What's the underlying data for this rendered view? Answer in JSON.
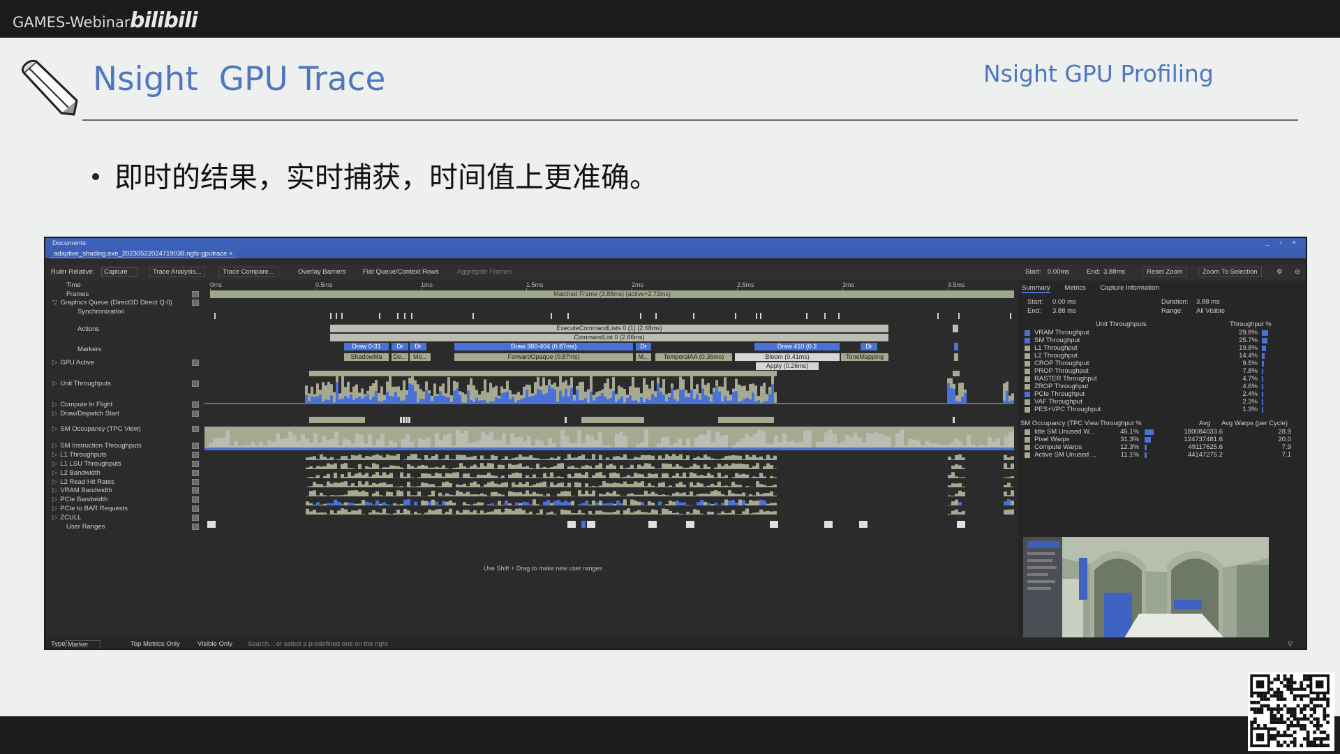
{
  "header": {
    "brand": "GAMES-Webinar",
    "brand_logo": "bilibili"
  },
  "slide": {
    "title": "Nsight  GPU Trace",
    "tag": "Nsight GPU Profiling",
    "bullet": "即时的结果，实时捕获，时间值上更准确。"
  },
  "window": {
    "title": "Documents",
    "doc_tab": "adaptive_shading.exe_20230522024719038.ngfx-gputrace",
    "toolbar": {
      "ruler_relative_label": "Ruler Relative:",
      "ruler_relative_value": "Capture",
      "trace_analysis": "Trace Analysis...",
      "trace_compare": "Trace Compare...",
      "overlay_barriers": "Overlay Barriers",
      "flat_queue": "Flat Queue/Context Rows",
      "aggregate_frames": "Aggregate Frames",
      "start_label": "Start:",
      "start_value": "0.00ms",
      "end_label": "End:",
      "end_value": "3.88ms",
      "reset_zoom": "Reset Zoom",
      "zoom_to_selection": "Zoom To Selection"
    },
    "ruler": [
      "0ms",
      "0.5ms",
      "1ms",
      "1.5ms",
      "2ms",
      "2.5ms",
      "3ms",
      "3.5ms"
    ],
    "rows": [
      {
        "label": "Time",
        "indent": 1,
        "tri": ""
      },
      {
        "label": "Frames",
        "indent": 1,
        "tri": ""
      },
      {
        "label": "Graphics Queue (Direct3D Direct Q:0)",
        "indent": 0,
        "tri": "▽"
      },
      {
        "label": "Synchronization",
        "indent": 2,
        "tri": ""
      },
      {
        "label": "Actions",
        "indent": 2,
        "tri": ""
      },
      {
        "label": "Markers",
        "indent": 2,
        "tri": ""
      },
      {
        "label": "GPU Active",
        "indent": 0,
        "tri": "▷"
      },
      {
        "label": "Unit Throughputs",
        "indent": 0,
        "tri": "▷"
      },
      {
        "label": "Compute In Flight",
        "indent": 0,
        "tri": "▷"
      },
      {
        "label": "Draw/Dispatch Start",
        "indent": 0,
        "tri": "▷"
      },
      {
        "label": "SM Occupancy (TPC View)",
        "indent": 0,
        "tri": "▷"
      },
      {
        "label": "SM Instruction Throughputs",
        "indent": 0,
        "tri": "▷"
      },
      {
        "label": "L1 Throughputs",
        "indent": 0,
        "tri": "▷"
      },
      {
        "label": "L1 LSU Throughputs",
        "indent": 0,
        "tri": "▷"
      },
      {
        "label": "L2 Bandwidth",
        "indent": 0,
        "tri": "▷"
      },
      {
        "label": "L2 Read Hit Rates",
        "indent": 0,
        "tri": "▷"
      },
      {
        "label": "VRAM Bandwidth",
        "indent": 0,
        "tri": "▷"
      },
      {
        "label": "PCIe Bandwidth",
        "indent": 0,
        "tri": "▷"
      },
      {
        "label": "PCIe to BAR Requests",
        "indent": 0,
        "tri": "▷"
      },
      {
        "label": "ZCULL",
        "indent": 0,
        "tri": "▷"
      },
      {
        "label": "User Ranges",
        "indent": 1,
        "tri": ""
      }
    ],
    "bars": {
      "matched_frame": "Matched Frame (3.88ms) (active+2.72ms)",
      "execute_command_lists": "ExecuteCommandLists 0 (1) (2.68ms)",
      "command_list": "CommandList 0 (2.66ms)",
      "draw_0_31": "Draw 0-31",
      "dr1": "Dr",
      "dr2": "Dr",
      "draw_360_404": "Draw 360-404 (0.87ms)",
      "dr3": "Dr",
      "draw_410": "Draw 410 (0.2",
      "dr4": "Dr",
      "shadowmap": "ShadowMa",
      "de": "De...",
      "mo": "Mo...",
      "forward_opaque": "ForwardOpaque (0.87ms)",
      "m": "M...",
      "temporal_aa": "TemporalAA (0.36ms)",
      "bloom": "Bloom (0.41ms)",
      "tonemapping": "ToneMapping",
      "apply": "Apply (0.26ms)"
    },
    "user_ranges_hint": "Use Shift + Drag to make new user ranges",
    "summary": {
      "tabs": [
        "Summary",
        "Metrics",
        "Capture Information"
      ],
      "start_label": "Start:",
      "start_value": "0.00 ms",
      "end_label": "End:",
      "end_value": "3.88 ms",
      "duration_label": "Duration:",
      "duration_value": "3.88 ms",
      "range_label": "Range:",
      "range_value": "All Visible",
      "unit_header": "Unit Throughputs",
      "throughput_header": "Throughput %",
      "unit_rows": [
        {
          "name": "VRAM Throughput",
          "pct": "29.8%",
          "value": 29.8,
          "color": "#4a72d6"
        },
        {
          "name": "SM Throughput",
          "pct": "25.7%",
          "value": 25.7,
          "color": "#4a72d6"
        },
        {
          "name": "L1 Throughput",
          "pct": "19.8%",
          "value": 19.8,
          "color": "#a6a890"
        },
        {
          "name": "L2 Throughput",
          "pct": "14.4%",
          "value": 14.4,
          "color": "#a6a890"
        },
        {
          "name": "CROP Throughput",
          "pct": "9.5%",
          "value": 9.5,
          "color": "#a6a890"
        },
        {
          "name": "PROP Throughput",
          "pct": "7.8%",
          "value": 7.8,
          "color": "#a6a890"
        },
        {
          "name": "RASTER Throughput",
          "pct": "4.7%",
          "value": 4.7,
          "color": "#a6a890"
        },
        {
          "name": "ZROP Throughput",
          "pct": "4.6%",
          "value": 4.6,
          "color": "#a6a890"
        },
        {
          "name": "PCIe Throughput",
          "pct": "2.4%",
          "value": 2.4,
          "color": "#4a72d6"
        },
        {
          "name": "VAF Throughput",
          "pct": "2.3%",
          "value": 2.3,
          "color": "#a6a890"
        },
        {
          "name": "PES+VPC Throughput",
          "pct": "1.3%",
          "value": 1.3,
          "color": "#a6a890"
        }
      ],
      "occ_headers": [
        "SM Occupancy (TPC View",
        "Throughput %",
        "Avg",
        "Avg Warps (per Cycle)"
      ],
      "occ_rows": [
        {
          "name": "Idle SM Unused W...",
          "pct": "45.1%",
          "value": 45.1,
          "avg": "180084033.6",
          "warps": "28.9",
          "color": "#a6a890"
        },
        {
          "name": "Pixel Warps",
          "pct": "31.3%",
          "value": 31.3,
          "avg": "124737481.6",
          "warps": "20.0",
          "color": "#a6a890"
        },
        {
          "name": "Compute Warps",
          "pct": "12.3%",
          "value": 12.3,
          "avg": "49117625.6",
          "warps": "7.9",
          "color": "#a6a890"
        },
        {
          "name": "Active SM Unused ...",
          "pct": "11.1%",
          "value": 11.1,
          "avg": "44147275.2",
          "warps": "7.1",
          "color": "#a6a890"
        }
      ]
    },
    "statusbar": {
      "type_label": "Type:",
      "type_value": "Marker",
      "top_metrics_only": "Top Metrics Only",
      "visible_only": "Visible Only",
      "search_placeholder": "Search... or select a predefined one on the right"
    }
  }
}
